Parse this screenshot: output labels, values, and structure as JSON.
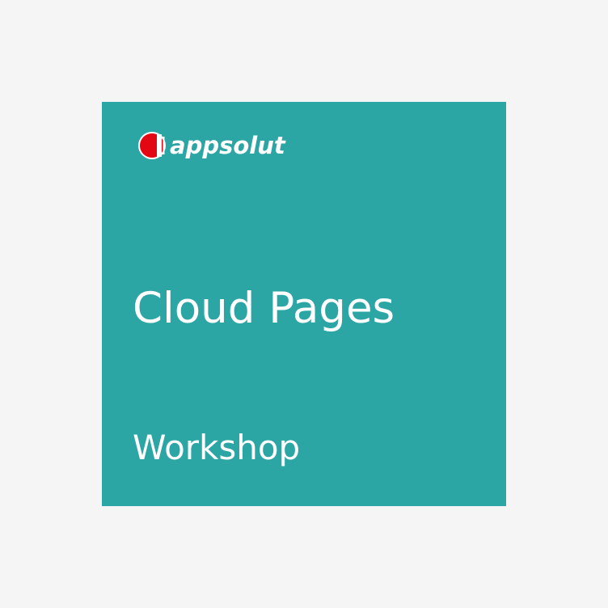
{
  "colors": {
    "background": "#f5f5f5",
    "card": "#2ca5a5",
    "text": "#ffffff",
    "logo_accent": "#e30613"
  },
  "logo": {
    "icon": "appsolut-logo-icon",
    "text": "appsolut"
  },
  "card": {
    "title": "Cloud Pages",
    "subtitle": "Workshop"
  }
}
